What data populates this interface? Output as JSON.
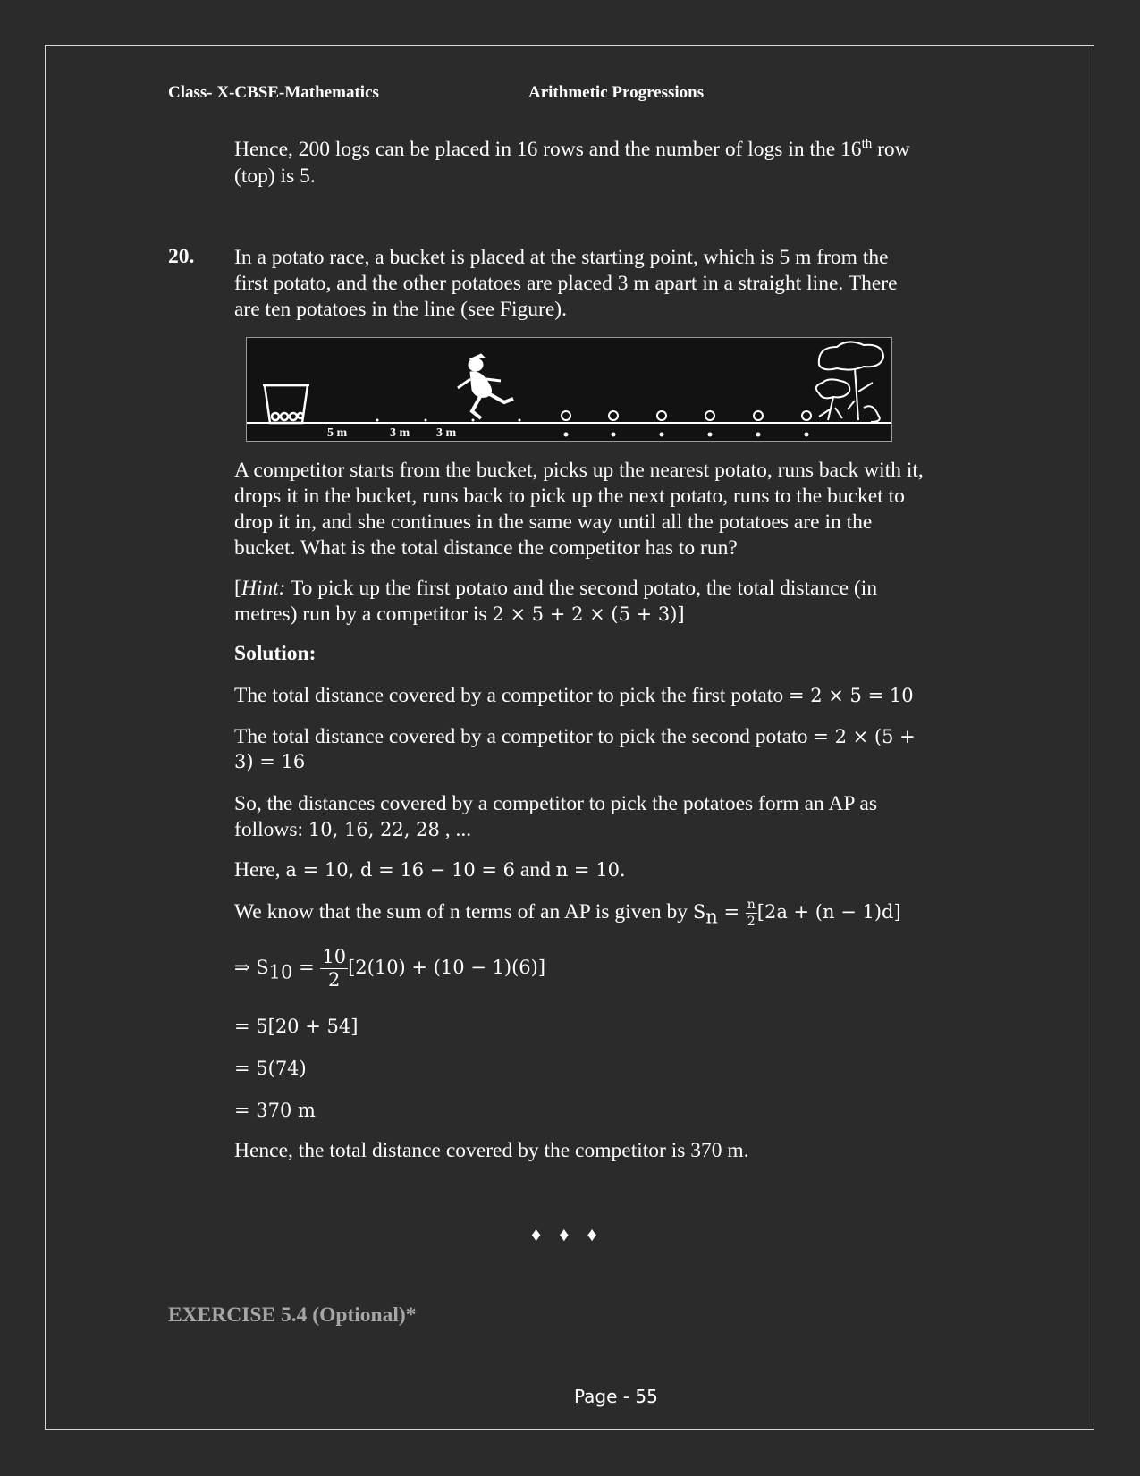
{
  "header": {
    "left": "Class- X-CBSE-Mathematics",
    "center": "Arithmetic Progressions"
  },
  "intro": {
    "line1_a": "Hence, 200 logs can be placed in 16 rows and the number of logs in the 16",
    "line1_sup": "th",
    "line1_b": " row",
    "line2": "(top) is 5."
  },
  "question": {
    "number": "20.",
    "lines": [
      "In a potato race, a bucket is placed at the starting point, which is 5 m from the",
      "first potato, and the other potatoes are placed 3 m apart in a straight line. There",
      "are ten potatoes in the line (see Figure)."
    ],
    "figure_labels": [
      "5 m",
      "3 m",
      "3 m"
    ],
    "body_lines": [
      "A competitor starts from the bucket, picks up the nearest potato, runs back with it,",
      "drops it in the bucket, runs back to pick up the next potato, runs to the bucket to",
      "drop it in, and she continues in the same way until all the potatoes are in the",
      "bucket. What is the total distance the competitor has to run?"
    ],
    "hint_open": "[",
    "hint_label": "Hint:",
    "hint_line1": " To pick up the first potato and the second potato, the total distance (in",
    "hint_line2_text": "metres) run by a competitor is ",
    "hint_line2_math": "2 × 5 + 2 × (5 + 3)]"
  },
  "solution": {
    "label": "Solution:",
    "line1_text": "The total distance covered by a competitor to pick the first potato ",
    "line1_math": "= 2 × 5 = 10",
    "line2_text": "The total distance covered by a competitor to pick the second potato ",
    "line2_math": "= 2 × (5 +",
    "line3_math": "3) = 16",
    "line4": "So, the distances covered by a competitor to pick the potatoes form an AP as",
    "line5_text": "follows: ",
    "line5_math": "10, 16, 22, 28",
    "line5_tail": " , ...",
    "line6_text1": "Here, ",
    "line6_math": "a = 10, d  = 16 − 10 = 6",
    "line6_text2": " and ",
    "line6_math2": "n = 10.",
    "line7_text": "We know that the sum of n terms of an AP is given by ",
    "line7_S": "S",
    "line7_sub": "n",
    "line7_eq": " = ",
    "line7_num": "n",
    "line7_den": "2",
    "line7_rest": "[2a + (n − 1)d]",
    "step1_prefix": "⇒ S",
    "step1_sub": "10",
    "step1_eq": " = ",
    "step1_num": "10",
    "step1_den": "2",
    "step1_rest": "[2(10) + (10 − 1)(6)]",
    "step2": "=  5[20 + 54]",
    "step3": "=  5(74)",
    "step4": "=  370 m",
    "conclusion": "Hence, the total distance covered by the competitor is 370 m."
  },
  "separator": "♦♦♦",
  "exercise": "EXERCISE 5.4 (Optional)*",
  "footer": {
    "page": "Page - 55"
  }
}
